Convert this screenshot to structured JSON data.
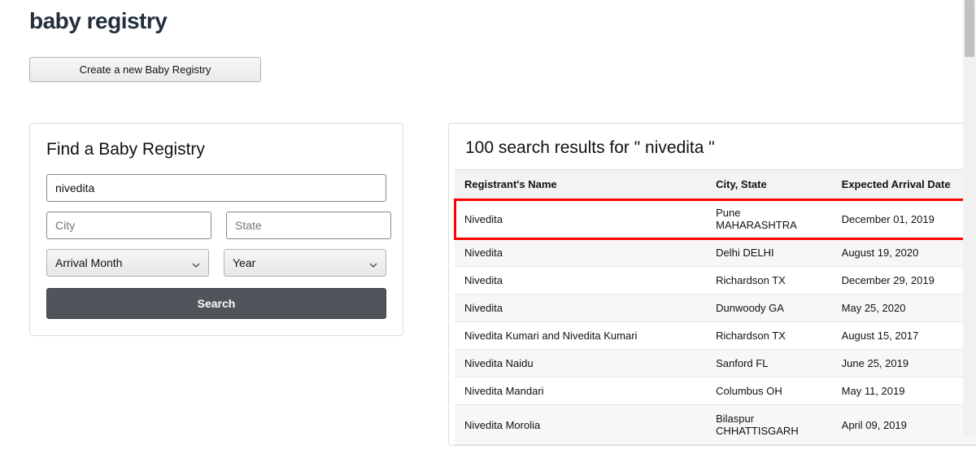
{
  "page_title": "baby registry",
  "create_button": "Create a new Baby Registry",
  "find": {
    "title": "Find a Baby Registry",
    "name_value": "nivedita",
    "city_placeholder": "City",
    "state_placeholder": "State",
    "month_label": "Arrival Month",
    "year_label": "Year",
    "search_button": "Search"
  },
  "results": {
    "title": "100 search results for \" nivedita \"",
    "columns": {
      "name": "Registrant's Name",
      "city": "City, State",
      "date": "Expected Arrival Date"
    },
    "rows": [
      {
        "name": "Nivedita",
        "city": "Pune MAHARASHTRA",
        "date": "December 01, 2019",
        "highlighted": true
      },
      {
        "name": "Nivedita",
        "city": "Delhi DELHI",
        "date": "August 19, 2020"
      },
      {
        "name": "Nivedita",
        "city": "Richardson TX",
        "date": "December 29, 2019"
      },
      {
        "name": "Nivedita",
        "city": "Dunwoody GA",
        "date": "May 25, 2020"
      },
      {
        "name": "Nivedita Kumari and Nivedita Kumari",
        "city": "Richardson TX",
        "date": "August 15, 2017"
      },
      {
        "name": "Nivedita Naidu",
        "city": "Sanford FL",
        "date": "June 25, 2019"
      },
      {
        "name": "Nivedita Mandari",
        "city": "Columbus OH",
        "date": "May 11, 2019"
      },
      {
        "name": "Nivedita Morolia",
        "city": "Bilaspur CHHATTISGARH",
        "date": "April 09, 2019"
      }
    ]
  }
}
